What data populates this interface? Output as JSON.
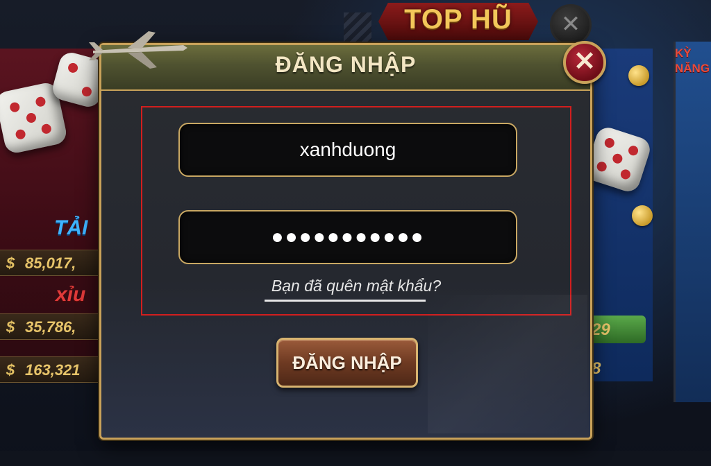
{
  "background": {
    "left_stats": [
      "85,017,",
      "35,786,",
      "163,321"
    ],
    "left_words": [
      "TẢI",
      "xỉu"
    ],
    "right_numbers": [
      "29",
      "8"
    ],
    "right_badge_lines": [
      "KỲ",
      "NĂNG"
    ],
    "top_banner": "TOP HŨ",
    "top_close": "✕",
    "currency_symbol": "$"
  },
  "dialog": {
    "title": "ĐĂNG NHẬP",
    "close_label": "✕",
    "username_value": "xanhduong",
    "password_value": "●●●●●●●●●●●",
    "forgot_text": "Bạn đã quên mật khẩu?",
    "submit_label": "ĐĂNG NHẬP"
  },
  "colors": {
    "accent_gold": "#c9a25a",
    "close_red": "#b8283a",
    "highlight_red": "#d21e1e"
  }
}
